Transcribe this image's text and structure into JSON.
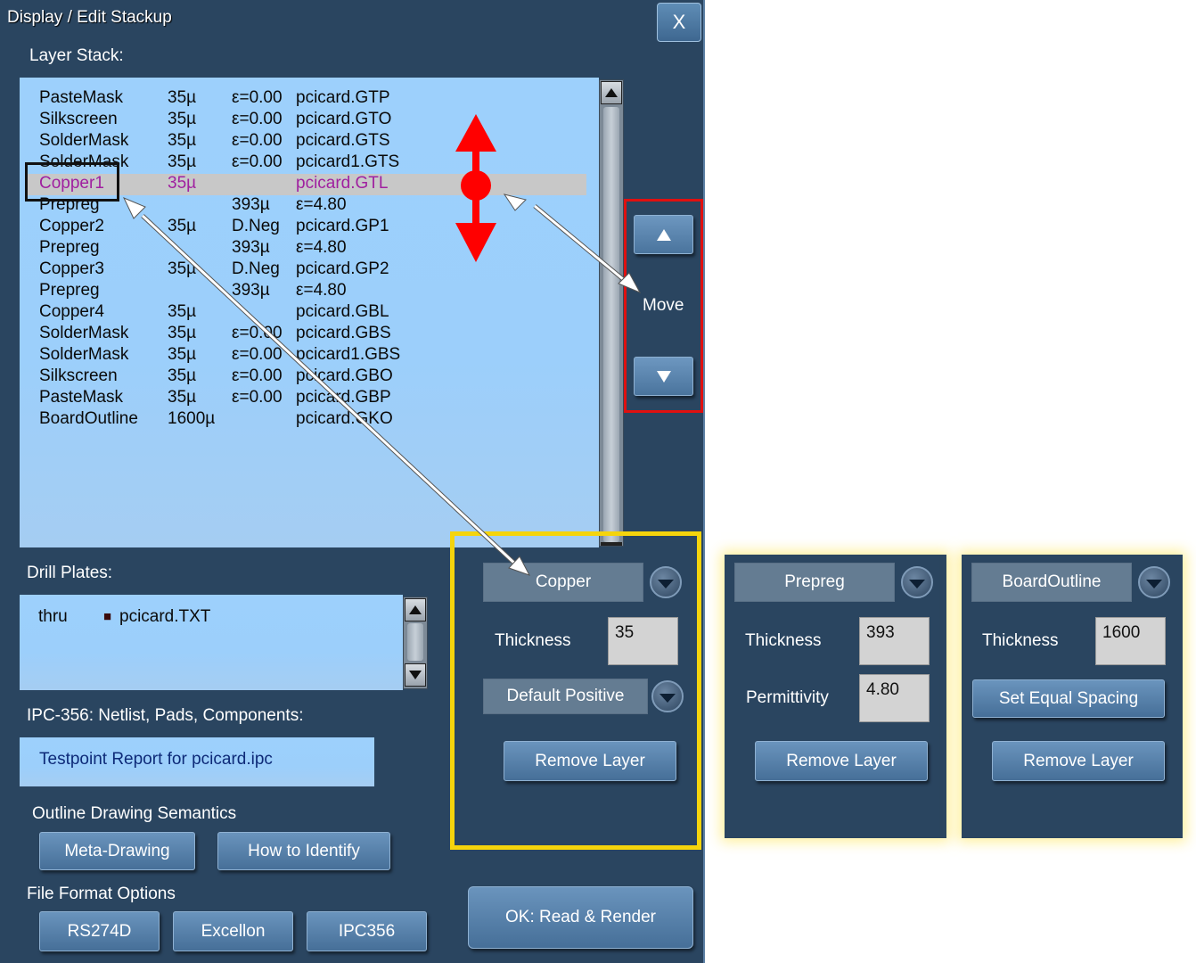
{
  "window": {
    "title": "Display / Edit Stackup",
    "close_label": "X"
  },
  "layer_stack": {
    "label": "Layer Stack:",
    "rows": [
      {
        "name": "PasteMask",
        "thickness": "35µ",
        "prop": "ε=0.00",
        "file": "pcicard.GTP"
      },
      {
        "name": "Silkscreen",
        "thickness": "35µ",
        "prop": "ε=0.00",
        "file": "pcicard.GTO"
      },
      {
        "name": "SolderMask",
        "thickness": "35µ",
        "prop": "ε=0.00",
        "file": "pcicard.GTS"
      },
      {
        "name": "SolderMask",
        "thickness": "35µ",
        "prop": "ε=0.00",
        "file": "pcicard1.GTS"
      },
      {
        "name": "Copper1",
        "thickness": "35µ",
        "prop": "",
        "file": "pcicard.GTL",
        "selected": true
      },
      {
        "name": "Prepreg",
        "thickness": "",
        "prop": "393µ",
        "file": "ε=4.80"
      },
      {
        "name": "Copper2",
        "thickness": "35µ",
        "prop": "D.Neg",
        "file": "pcicard.GP1"
      },
      {
        "name": "Prepreg",
        "thickness": "",
        "prop": "393µ",
        "file": "ε=4.80"
      },
      {
        "name": "Copper3",
        "thickness": "35µ",
        "prop": "D.Neg",
        "file": "pcicard.GP2"
      },
      {
        "name": "Prepreg",
        "thickness": "",
        "prop": "393µ",
        "file": "ε=4.80"
      },
      {
        "name": "Copper4",
        "thickness": "35µ",
        "prop": "",
        "file": "pcicard.GBL"
      },
      {
        "name": "SolderMask",
        "thickness": "35µ",
        "prop": "ε=0.00",
        "file": "pcicard.GBS"
      },
      {
        "name": "SolderMask",
        "thickness": "35µ",
        "prop": "ε=0.00",
        "file": "pcicard1.GBS"
      },
      {
        "name": "Silkscreen",
        "thickness": "35µ",
        "prop": "ε=0.00",
        "file": "pcicard.GBO"
      },
      {
        "name": "PasteMask",
        "thickness": "35µ",
        "prop": "ε=0.00",
        "file": "pcicard.GBP"
      },
      {
        "name": "BoardOutline",
        "thickness": "1600µ",
        "prop": "",
        "file": "pcicard.GKO"
      }
    ]
  },
  "move": {
    "label": "Move",
    "up_icon": "triangle-up",
    "down_icon": "triangle-down"
  },
  "drill_plates": {
    "label": "Drill Plates:",
    "rows": [
      {
        "type": "thru",
        "bullet": "■",
        "file": "pcicard.TXT"
      }
    ]
  },
  "ipc": {
    "label": "IPC-356: Netlist, Pads, Components:",
    "report_link": "Testpoint Report for pcicard.ipc"
  },
  "outline": {
    "label": "Outline Drawing Semantics",
    "meta_drawing": "Meta-Drawing",
    "how_to_identify": "How to Identify"
  },
  "file_format": {
    "label": "File Format Options",
    "rs274d": "RS274D",
    "excellon": "Excellon",
    "ipc356": "IPC356"
  },
  "ok_button": "OK:  Read & Render",
  "copper_panel": {
    "type": "Copper",
    "thickness_label": "Thickness",
    "thickness_value": "35",
    "polarity": "Default Positive",
    "remove": "Remove Layer"
  },
  "prepreg_panel": {
    "type": "Prepreg",
    "thickness_label": "Thickness",
    "thickness_value": "393",
    "permittivity_label": "Permittivity",
    "permittivity_value": "4.80",
    "remove": "Remove Layer"
  },
  "outline_panel": {
    "type": "BoardOutline",
    "thickness_label": "Thickness",
    "thickness_value": "1600",
    "equal_spacing": "Set Equal Spacing",
    "remove": "Remove Layer"
  },
  "colors": {
    "dialog_bg": "#2a4560",
    "list_bg": "#9dd0fc",
    "selected_text": "#a020a0",
    "highlight_yellow": "#f5d40c",
    "highlight_red": "#e01010",
    "arrow_red": "#ff0000"
  }
}
